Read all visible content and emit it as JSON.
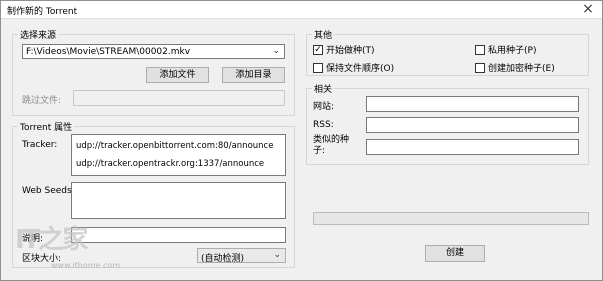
{
  "window": {
    "title": "制作新的 Torrent",
    "close_glyph": "×"
  },
  "source": {
    "legend": "选择来源",
    "path": "F:\\Videos\\Movie\\STREAM\\00002.mkv",
    "add_file": "添加文件",
    "add_dir": "添加目录",
    "skip_label": "跳过文件:"
  },
  "torrent": {
    "legend": "Torrent 属性",
    "tracker_label": "Tracker:",
    "trackers": [
      "udp://tracker.openbittorrent.com:80/announce",
      "udp://tracker.opentrackr.org:1337/announce"
    ],
    "webseeds_label": "Web Seeds:",
    "comment_label": "说明:",
    "piece_label": "区块大小:",
    "piece_value": "(自动检测)"
  },
  "other": {
    "legend": "其他",
    "start_seed": {
      "label": "开始做种(T)",
      "checked": true
    },
    "private": {
      "label": "私用种子(P)",
      "checked": false
    },
    "keep_order": {
      "label": "保持文件顺序(O)",
      "checked": false
    },
    "encrypted": {
      "label": "创建加密种子(E)",
      "checked": false
    }
  },
  "related": {
    "legend": "相关",
    "website_label": "网站:",
    "rss_label": "RSS:",
    "similar_label_1": "类似的种",
    "similar_label_2": "子:"
  },
  "progress": {
    "value": 0
  },
  "create_button": "创建",
  "watermark": {
    "text": "IT之家",
    "url": "www.ithome.com"
  }
}
